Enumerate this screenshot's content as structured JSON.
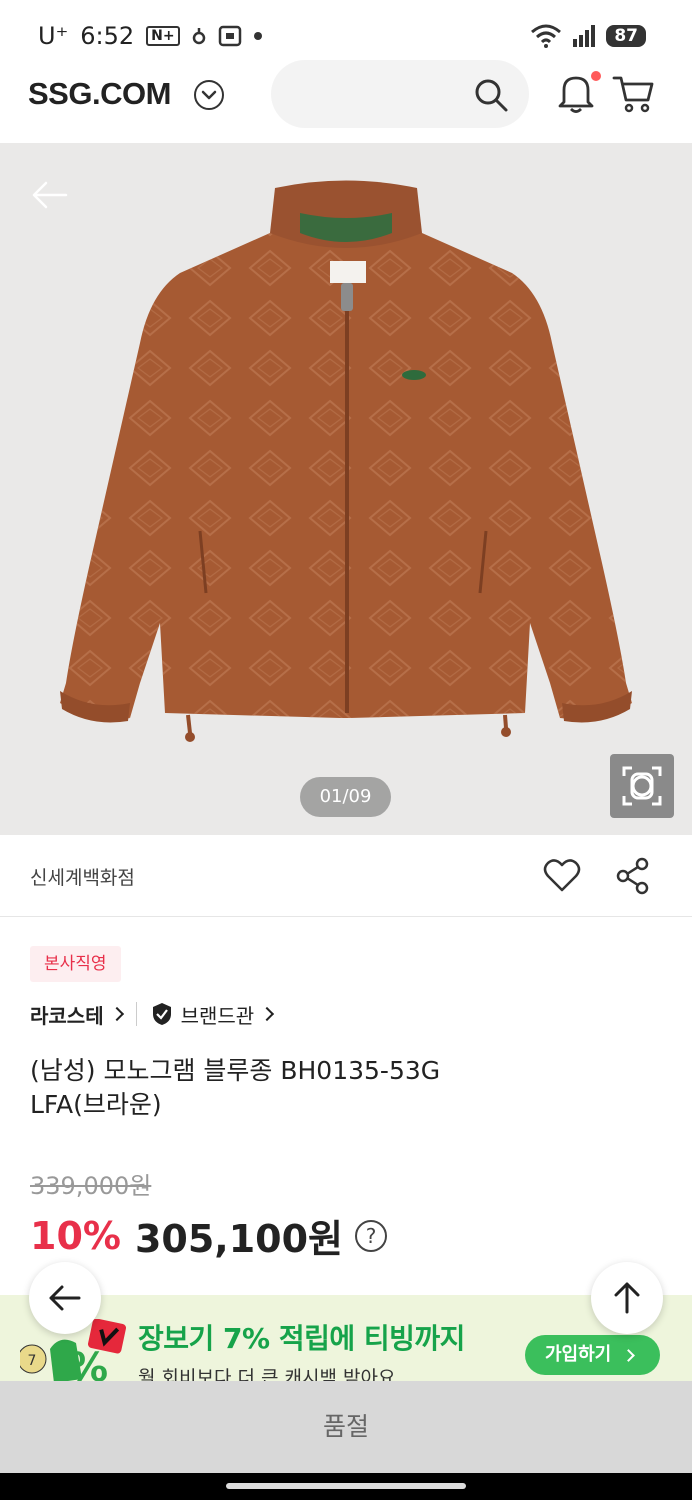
{
  "status_bar": {
    "carrier": "U⁺",
    "time": "6:52",
    "nfc": "N+",
    "battery": "87"
  },
  "header": {
    "logo": "SSG.COM"
  },
  "gallery": {
    "counter": "01/09"
  },
  "seller": {
    "name": "신세계백화점"
  },
  "badge": "본사직영",
  "brand": {
    "name": "라코스테",
    "store_label": "브랜드관"
  },
  "product": {
    "title": "(남성) 모노그램 블루종 BH0135-53G LFA(브라운)",
    "original_price": "339,000원",
    "discount": "10%",
    "price": "305,100원",
    "help": "?"
  },
  "promo": {
    "title": "장보기 7% 적립에 티빙까지",
    "subtitle": "월 회비보다 더 큰 캐시백 받아요",
    "button": "가입하기"
  },
  "bottom_bar": {
    "label": "품절"
  },
  "colors": {
    "accent_red": "#e8304a",
    "promo_green": "#16a34a",
    "jacket_brown": "#a65a33"
  }
}
